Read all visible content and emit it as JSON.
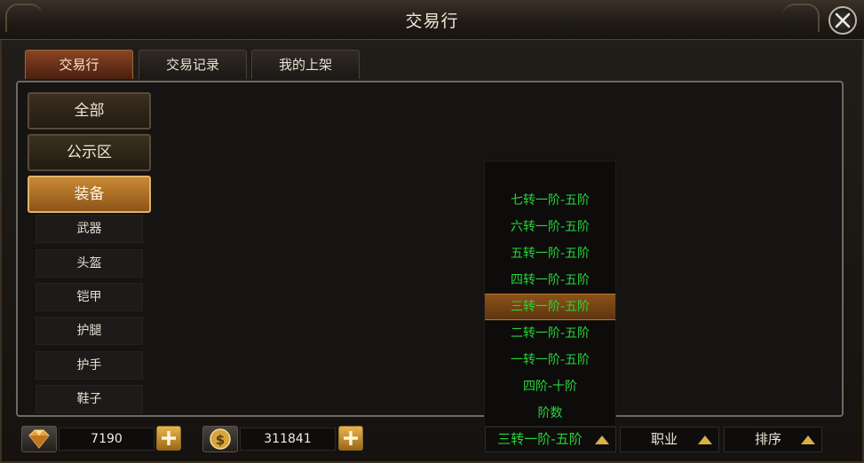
{
  "window": {
    "title": "交易行"
  },
  "tabs": [
    {
      "label": "交易行",
      "active": true
    },
    {
      "label": "交易记录",
      "active": false
    },
    {
      "label": "我的上架",
      "active": false
    }
  ],
  "categories": [
    {
      "label": "全部"
    },
    {
      "label": "公示区"
    },
    {
      "label": "装备",
      "active": true
    }
  ],
  "subcategories": [
    "武器",
    "头盔",
    "铠甲",
    "护腿",
    "护手",
    "鞋子"
  ],
  "dropdown": {
    "options": [
      "七转一阶-五阶",
      "六转一阶-五阶",
      "五转一阶-五阶",
      "四转一阶-五阶",
      "三转一阶-五阶",
      "二转一阶-五阶",
      "一转一阶-五阶",
      "四阶-十阶",
      "阶数"
    ],
    "selected": "三转一阶-五阶"
  },
  "currency": {
    "gems": {
      "icon": "gem-icon",
      "value": "7190"
    },
    "gold": {
      "icon": "gold-coin-icon",
      "value": "311841"
    }
  },
  "filters": {
    "tier": {
      "label": "三转一阶-五阶"
    },
    "class": {
      "label": "职业"
    },
    "sort": {
      "label": "排序"
    }
  },
  "colors": {
    "accent": "#c98a35",
    "option_text": "#27d43a",
    "tab_active": "#8a4422"
  }
}
